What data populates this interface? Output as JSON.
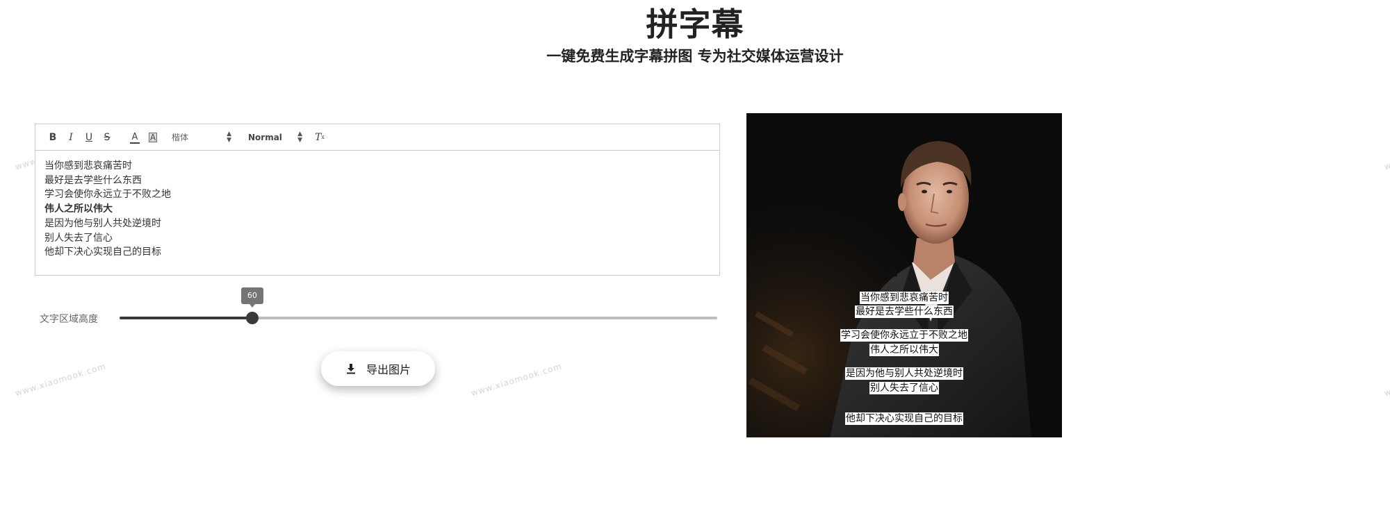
{
  "header": {
    "title": "拼字幕",
    "subtitle": "一键免费生成字幕拼图 专为社交媒体运营设计"
  },
  "watermark": "www.xiaomook.com",
  "toolbar": {
    "bold": "B",
    "italic": "I",
    "underline": "U",
    "strike": "S",
    "color": "A",
    "background": "A",
    "font": "楷体",
    "size": "Normal",
    "clear": "T"
  },
  "editor": {
    "lines": [
      "当你感到悲哀痛苦时",
      "最好是去学些什么东西",
      "学习会使你永远立于不败之地",
      "伟人之所以伟大",
      "是因为他与别人共处逆境时",
      "别人失去了信心",
      "他却下决心实现自己的目标"
    ]
  },
  "slider": {
    "label": "文字区域高度",
    "value": "60",
    "fraction": 0.222
  },
  "export": {
    "label": "导出图片"
  },
  "preview": {
    "captions": [
      "当你感到悲哀痛苦时",
      "最好是去学些什么东西",
      "学习会使你永远立于不败之地",
      "伟人之所以伟大",
      "是因为他与别人共处逆境时",
      "别人失去了信心",
      "他却下决心实现自己的目标"
    ]
  }
}
